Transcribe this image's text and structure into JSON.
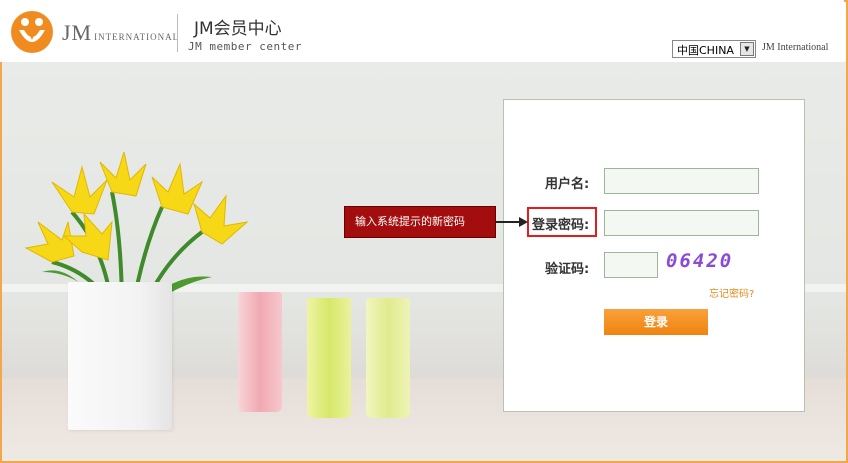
{
  "header": {
    "logo_big": "JM",
    "logo_small": "INTERNATIONAL",
    "title": "JM会员中心",
    "subtitle": "JM member center",
    "region_value": "中国CHINA",
    "intl_label": "JM International"
  },
  "form": {
    "username_label": "用户名:",
    "password_label": "登录密码:",
    "captcha_label": "验证码:",
    "captcha_code": "06420",
    "forgot_link": "忘记密码?",
    "login_button": "登录"
  },
  "annotation": {
    "callout_text": "输入系统提示的新密码"
  },
  "colors": {
    "accent_orange": "#f0830f",
    "callout_red": "#a30d0d",
    "highlight_red": "#e31d1d",
    "captcha_purple": "#8a4bd6",
    "frame_border": "#f3a64a"
  }
}
